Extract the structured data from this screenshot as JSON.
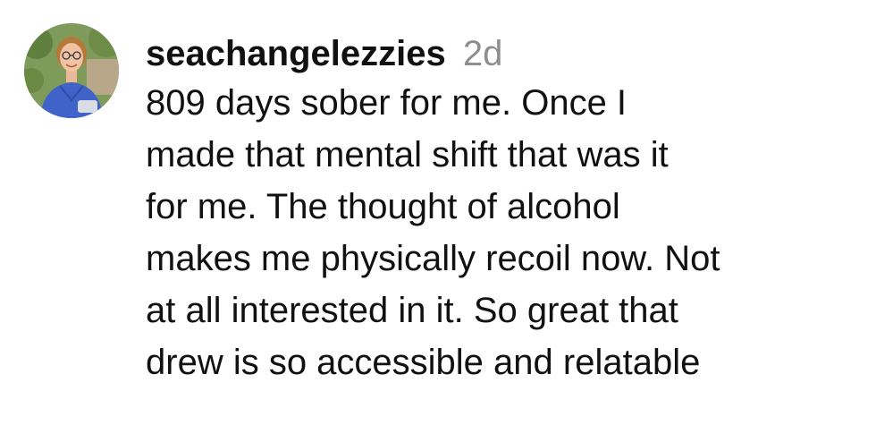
{
  "comment": {
    "username": "seachangelezzies",
    "timestamp": "2d",
    "avatar_icon": "profile-photo",
    "lines": [
      "809 days sober for me. Once I",
      "made that mental shift that was it",
      "for me. The thought of alcohol",
      "makes me physically recoil now. Not",
      "at all interested in it. So great that",
      "drew is so accessible and relatable"
    ]
  },
  "colors": {
    "text": "#111111",
    "timestamp": "#8e8e8e",
    "background": "#ffffff"
  }
}
